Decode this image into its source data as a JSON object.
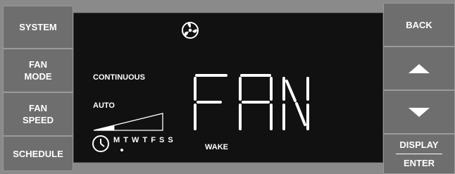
{
  "left_buttons": {
    "system": "SYSTEM",
    "fan_mode": [
      "FAN",
      "MODE"
    ],
    "fan_speed": [
      "FAN",
      "SPEED"
    ],
    "schedule": "SCHEDULE"
  },
  "right_buttons": {
    "back": "BACK",
    "display": "DISPLAY",
    "enter": "ENTER"
  },
  "lcd": {
    "continuous_label": "CONTINUOUS",
    "auto_label": "AUTO",
    "main_text": "FAN",
    "days": "M T W T F S S",
    "wake_label": "WAKE",
    "speed_level_fraction": 0.3
  },
  "colors": {
    "frame": "#8a8a8a",
    "button": "#6e6e6e",
    "lcd_background": "#111111",
    "lcd_foreground": "#ffffff"
  },
  "icons": {
    "fan": "fan-icon",
    "clock": "clock-icon",
    "up": "up-arrow-icon",
    "down": "down-arrow-icon"
  }
}
